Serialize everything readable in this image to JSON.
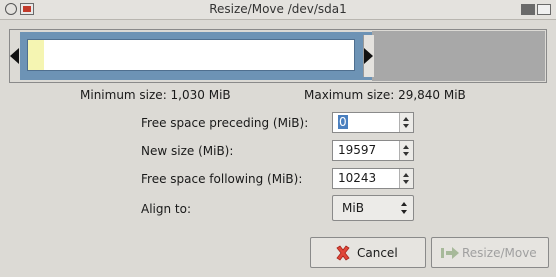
{
  "window": {
    "title": "Resize/Move /dev/sda1"
  },
  "partition": {
    "min_size_label": "Minimum size: 1,030 MiB",
    "max_size_label": "Maximum size: 29,840 MiB"
  },
  "form": {
    "free_before_label": "Free space preceding (MiB):",
    "free_before_value": "0",
    "new_size_label": "New size (MiB):",
    "new_size_value": "19597",
    "free_after_label": "Free space following (MiB):",
    "free_after_value": "10243",
    "align_label": "Align to:",
    "align_value": "MiB"
  },
  "buttons": {
    "cancel_label": "Cancel",
    "resize_label": "Resize/Move"
  },
  "icons": {
    "cancel": "cancel-x-icon",
    "resize": "resize-arrow-icon"
  }
}
